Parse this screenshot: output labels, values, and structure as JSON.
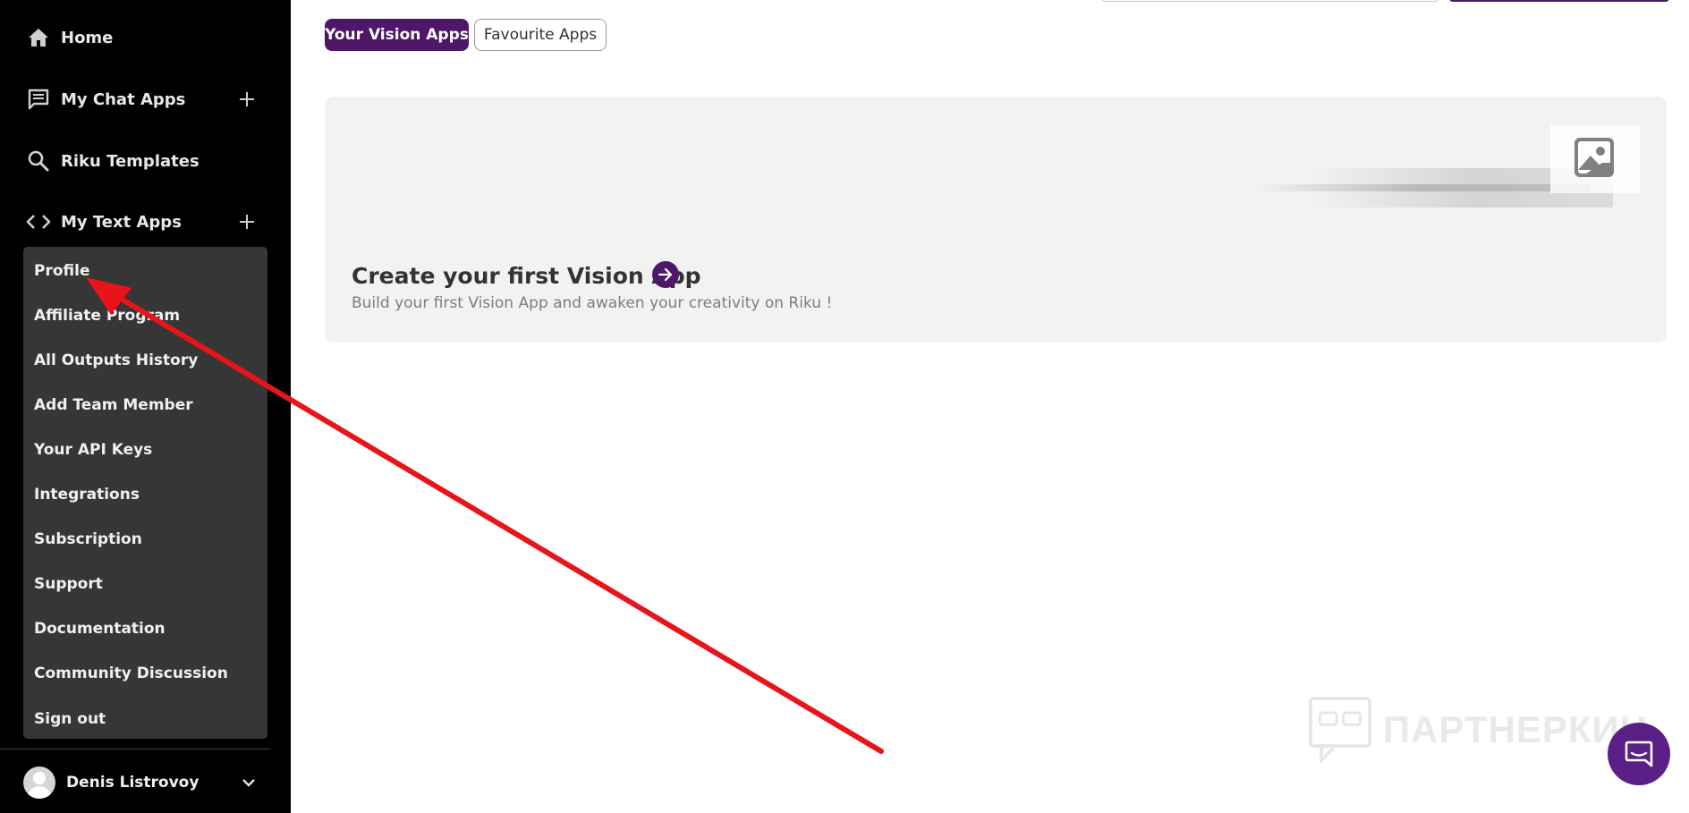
{
  "sidebar": {
    "nav": [
      {
        "label": "Home",
        "icon": "home-icon"
      },
      {
        "label": "My Chat Apps",
        "icon": "chat-icon",
        "action_icon": "plus-icon"
      },
      {
        "label": "Riku Templates",
        "icon": "search-icon"
      },
      {
        "label": "My Text Apps",
        "icon": "code-icon",
        "action_icon": "plus-icon"
      }
    ],
    "menu": [
      "Profile",
      "Affiliate Program",
      "All Outputs History",
      "Add Team Member",
      "Your API Keys",
      "Integrations",
      "Subscription",
      "Support",
      "Documentation",
      "Community Discussion",
      "Sign out"
    ],
    "user": {
      "name": "Denis Listrovoy",
      "icon": "chevron-down-icon"
    }
  },
  "tabs": [
    {
      "label": "Your Vision Apps",
      "active": true
    },
    {
      "label": "Favourite Apps",
      "active": false
    }
  ],
  "card": {
    "title": "Create your first Vision App",
    "description": "Build your first Vision App and awaken your creativity on Riku !"
  },
  "watermark": {
    "text": "ПАРТНЕРКИН"
  },
  "colors": {
    "brand": "#4e1768",
    "sidebar_bg": "#000000",
    "menu_bg": "#363636",
    "annotation_arrow": "#e8141b"
  }
}
